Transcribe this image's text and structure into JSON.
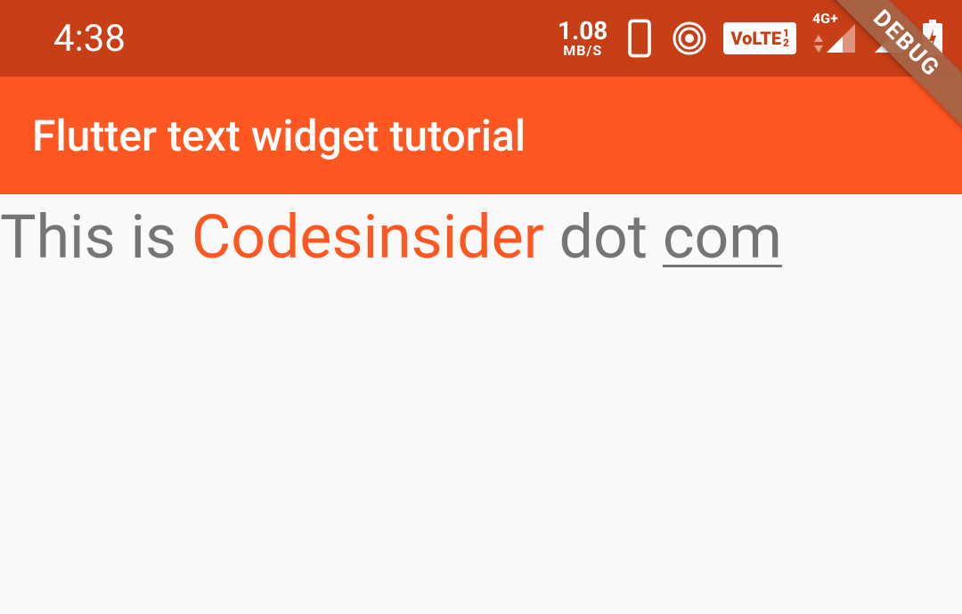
{
  "statusBar": {
    "time": "4:38",
    "speed": {
      "value": "1.08",
      "unit": "MB/S"
    },
    "network": {
      "volte": "VoLTE",
      "gen": "4G+"
    }
  },
  "appBar": {
    "title": "Flutter text widget tutorial"
  },
  "content": {
    "spans": {
      "prefix": "This is ",
      "highlight": "Codesinsider",
      "mid": " dot ",
      "underlined": "com"
    }
  },
  "debug": {
    "label": "DEBUG"
  }
}
